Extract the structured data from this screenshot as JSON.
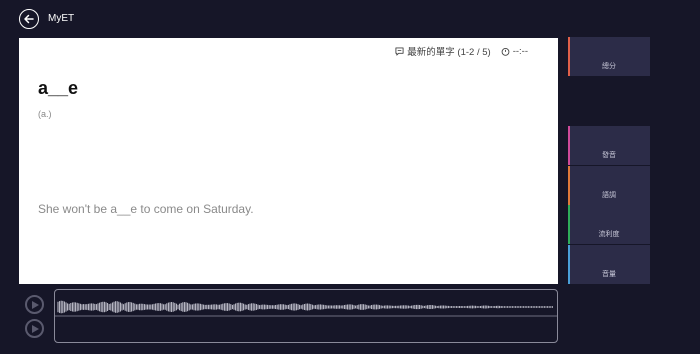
{
  "header": {
    "title": "MyET"
  },
  "card": {
    "progress_label": "最新的單字 (1-2 / 5)",
    "timer": "--:--",
    "word": "a__e",
    "part_of_speech": "(a.)",
    "sentence": "She won't be a__e to come on Saturday."
  },
  "side_panel": [
    {
      "label": "總分",
      "accent": "#e0604a"
    },
    {
      "label": "發音",
      "accent": "#d04a9a"
    },
    {
      "label": "語調",
      "accent": "#e07a3a"
    },
    {
      "label": "流利度",
      "accent": "#2fae5a"
    },
    {
      "label": "音量",
      "accent": "#4aa0d8"
    }
  ],
  "colors": {
    "background": "#161628",
    "side_button": "#2c2c48",
    "card": "#ffffff"
  },
  "icons": {
    "back": "back-arrow-icon",
    "progress": "chat-bubble-icon",
    "timer": "timer-icon",
    "play": "play-icon"
  }
}
